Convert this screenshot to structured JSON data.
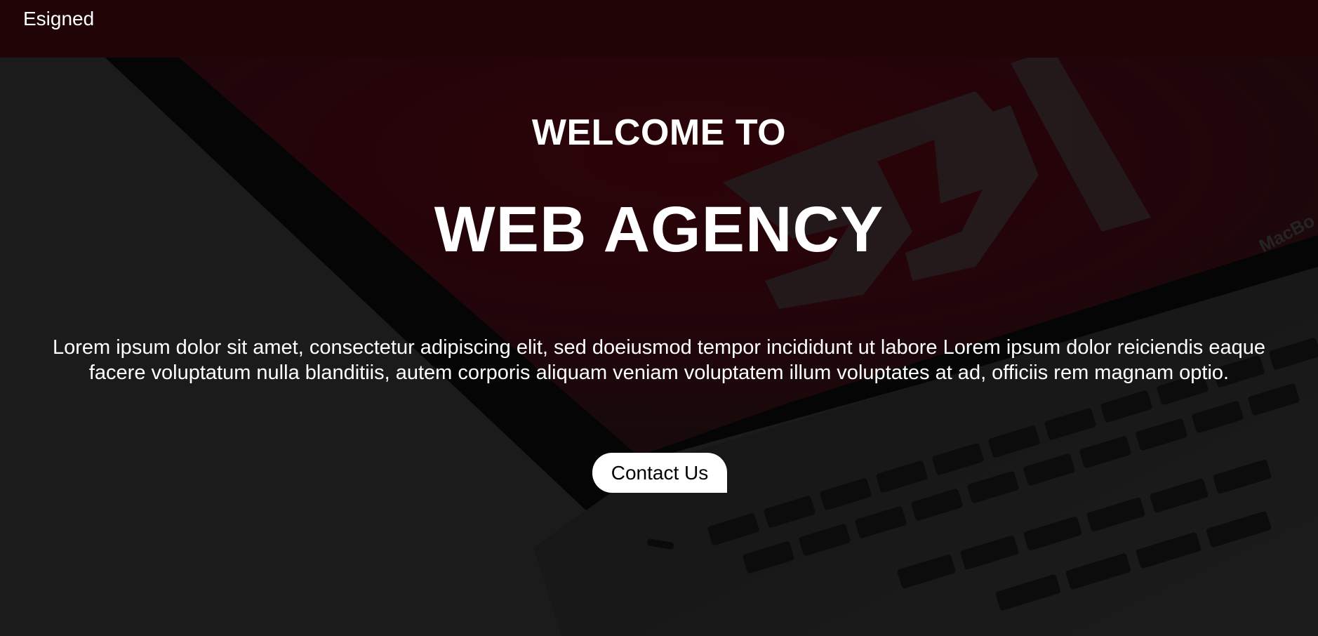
{
  "navbar": {
    "brand": "Esigned"
  },
  "hero": {
    "welcome": "WELCOME TO",
    "headline": "WEB AGENCY",
    "description_line1": "Lorem ipsum dolor sit amet, consectetur adipiscing elit, sed doeiusmod tempor incididunt ut labore Lorem ipsum dolor reiciendis eaque",
    "description_line2": "facere voluptatum nulla blanditiis, autem corporis aliquam veniam voluptatem illum voluptates at ad, officiis rem magnam optio.",
    "cta_label": "Contact Us"
  },
  "background": {
    "screen_logo": "55",
    "laptop_brand": "MacBo"
  },
  "colors": {
    "navbar_bg": "#200406",
    "screen_red": "#2a0306",
    "page_bg": "#1b1b1b",
    "button_bg": "#ffffff"
  }
}
